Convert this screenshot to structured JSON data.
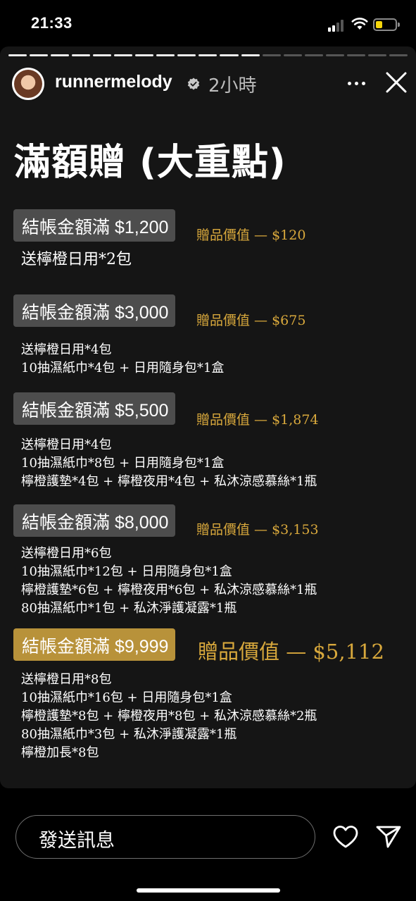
{
  "status_bar": {
    "time": "21:33"
  },
  "story": {
    "progress_segments": 19,
    "progress_done": 12,
    "username": "runnermelody",
    "time_ago": "2小時",
    "headline": "滿額贈 (大重點)"
  },
  "tiers": [
    {
      "threshold": "結帳金額滿 $1,200",
      "gift_value": "贈品價值 — $120",
      "items": [
        "送檸橙日用*2包"
      ]
    },
    {
      "threshold": "結帳金額滿 $3,000",
      "gift_value": "贈品價值 — $675",
      "items": [
        "送檸橙日用*4包",
        "10抽濕紙巾*4包 + 日用隨身包*1盒"
      ]
    },
    {
      "threshold": "結帳金額滿 $5,500",
      "gift_value": "贈品價值 — $1,874",
      "items": [
        "送檸橙日用*4包",
        "10抽濕紙巾*8包 + 日用隨身包*1盒",
        "檸橙護墊*4包 + 檸橙夜用*4包 + 私沐涼感慕絲*1瓶"
      ]
    },
    {
      "threshold": "結帳金額滿 $8,000",
      "gift_value": "贈品價值 — $3,153",
      "items": [
        "送檸橙日用*6包",
        "10抽濕紙巾*12包 + 日用隨身包*1盒",
        "檸橙護墊*6包 + 檸橙夜用*6包 + 私沐涼感慕絲*1瓶",
        "80抽濕紙巾*1包 + 私沐淨護凝露*1瓶"
      ]
    },
    {
      "threshold": "結帳金額滿 $9,999",
      "gift_value": "贈品價值 — $5,112",
      "items": [
        "送檸橙日用*8包",
        "10抽濕紙巾*16包 + 日用隨身包*1盒",
        "檸橙護墊*8包 + 檸橙夜用*8包 + 私沐涼感慕絲*2瓶",
        "80抽濕紙巾*3包 + 私沐淨護凝露*1瓶",
        "檸橙加長*8包"
      ]
    }
  ],
  "reply": {
    "placeholder": "發送訊息"
  },
  "icons": {
    "more": "more-dots-icon",
    "close": "close-icon",
    "like": "heart-icon",
    "share": "send-icon"
  },
  "colors": {
    "gold_accent": "#d8a83c",
    "gold_pill": "#b8923a",
    "pill_gray": "#4d4d4d",
    "story_bg": "#151515"
  }
}
